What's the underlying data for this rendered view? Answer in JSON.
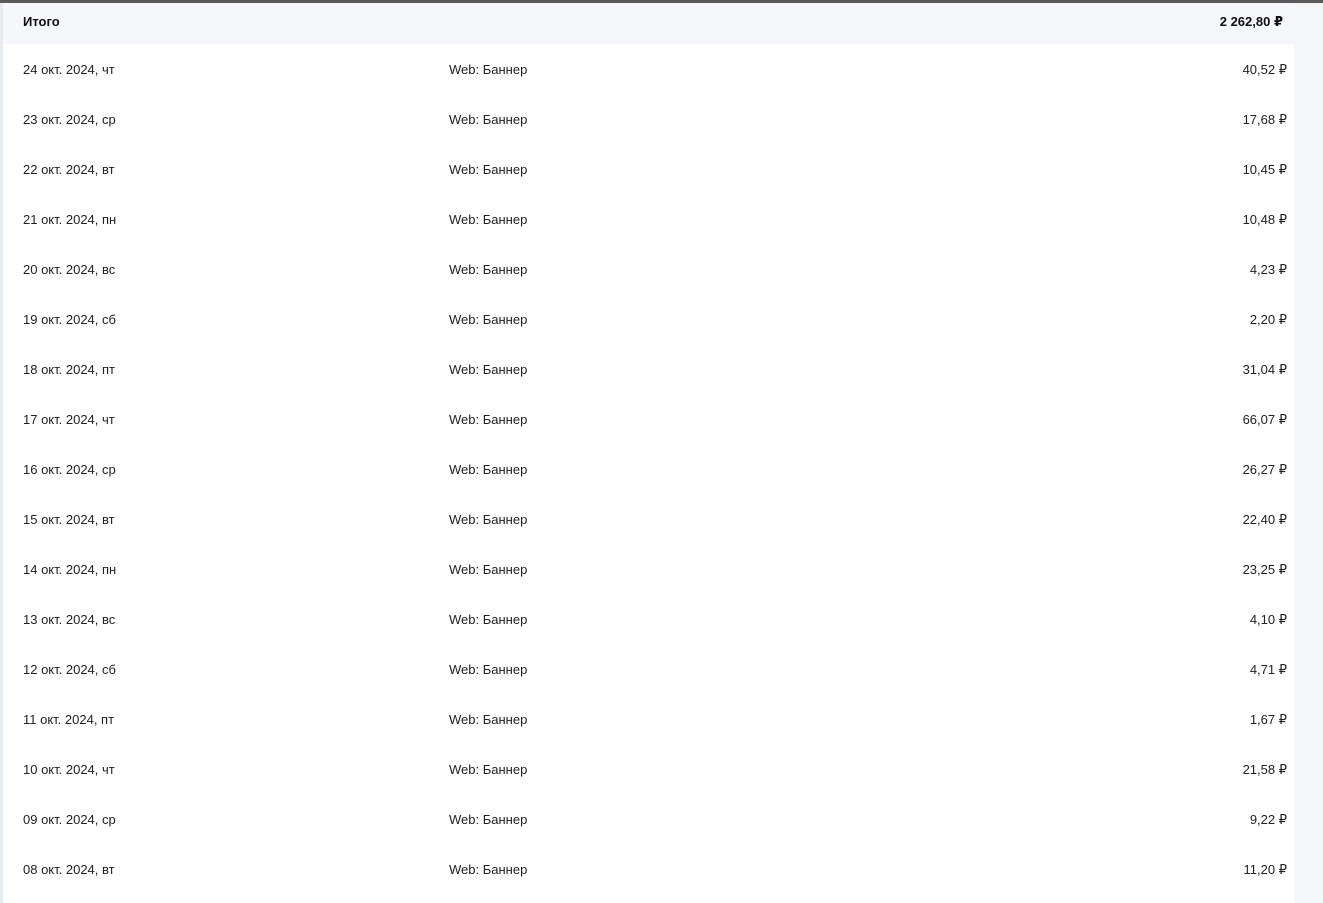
{
  "total": {
    "label": "Итого",
    "value": "2 262,80 ₽"
  },
  "rows": [
    {
      "date": "24 окт. 2024, чт",
      "type": "Web: Баннер",
      "amount": "40,52 ₽"
    },
    {
      "date": "23 окт. 2024, ср",
      "type": "Web: Баннер",
      "amount": "17,68 ₽"
    },
    {
      "date": "22 окт. 2024, вт",
      "type": "Web: Баннер",
      "amount": "10,45 ₽"
    },
    {
      "date": "21 окт. 2024, пн",
      "type": "Web: Баннер",
      "amount": "10,48 ₽"
    },
    {
      "date": "20 окт. 2024, вс",
      "type": "Web: Баннер",
      "amount": "4,23 ₽"
    },
    {
      "date": "19 окт. 2024, сб",
      "type": "Web: Баннер",
      "amount": "2,20 ₽"
    },
    {
      "date": "18 окт. 2024, пт",
      "type": "Web: Баннер",
      "amount": "31,04 ₽"
    },
    {
      "date": "17 окт. 2024, чт",
      "type": "Web: Баннер",
      "amount": "66,07 ₽"
    },
    {
      "date": "16 окт. 2024, ср",
      "type": "Web: Баннер",
      "amount": "26,27 ₽"
    },
    {
      "date": "15 окт. 2024, вт",
      "type": "Web: Баннер",
      "amount": "22,40 ₽"
    },
    {
      "date": "14 окт. 2024, пн",
      "type": "Web: Баннер",
      "amount": "23,25 ₽"
    },
    {
      "date": "13 окт. 2024, вс",
      "type": "Web: Баннер",
      "amount": "4,10 ₽"
    },
    {
      "date": "12 окт. 2024, сб",
      "type": "Web: Баннер",
      "amount": "4,71 ₽"
    },
    {
      "date": "11 окт. 2024, пт",
      "type": "Web: Баннер",
      "amount": "1,67 ₽"
    },
    {
      "date": "10 окт. 2024, чт",
      "type": "Web: Баннер",
      "amount": "21,58 ₽"
    },
    {
      "date": "09 окт. 2024, ср",
      "type": "Web: Баннер",
      "amount": "9,22 ₽"
    },
    {
      "date": "08 окт. 2024, вт",
      "type": "Web: Баннер",
      "amount": "11,20 ₽"
    }
  ]
}
